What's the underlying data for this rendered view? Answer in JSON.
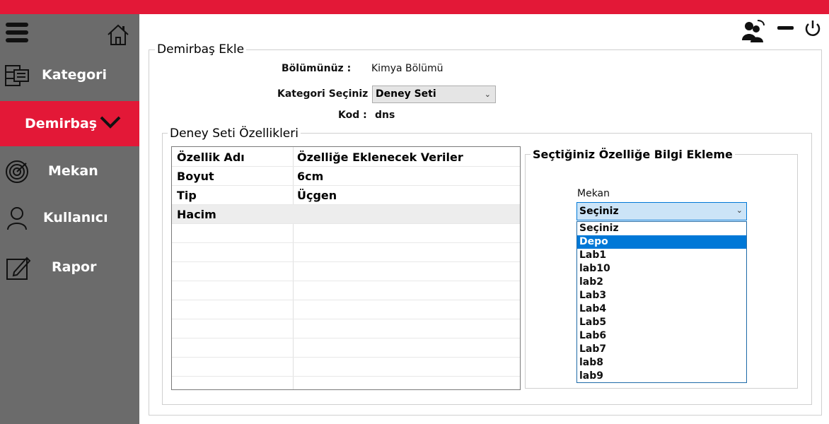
{
  "colors": {
    "accent": "#e31837",
    "sidebar": "#6b6b6b",
    "highlight": "#0078d7"
  },
  "sidebar": {
    "items": [
      {
        "label": "Kategori",
        "icon": "server-icon"
      },
      {
        "label": "Demirbaş",
        "icon": "chevron-down-icon",
        "active": true
      },
      {
        "label": "Mekan",
        "icon": "radar-icon"
      },
      {
        "label": "Kullanıcı",
        "icon": "user-icon"
      },
      {
        "label": "Rapor",
        "icon": "edit-icon"
      }
    ]
  },
  "form": {
    "title": "Demirbaş Ekle",
    "department_label": "Bölümünüz :",
    "department_value": "Kimya Bölümü",
    "category_label": "Kategori Seçiniz :",
    "category_value": "Deney Seti",
    "code_label": "Kod :",
    "code_value": "dns"
  },
  "properties": {
    "title": "Deney Seti Özellikleri",
    "columns": [
      "Özellik Adı",
      "Özelliğe Eklenecek Veriler"
    ],
    "rows": [
      [
        "Boyut",
        "6cm"
      ],
      [
        "Tip",
        "Üçgen"
      ],
      [
        "Hacim",
        ""
      ]
    ]
  },
  "info_panel": {
    "title": "Seçtiğiniz Özelliğe Bilgi Ekleme",
    "location_label": "Mekan",
    "location_value": "Seçiniz",
    "options": [
      "Seçiniz",
      "Depo",
      "Lab1",
      "lab10",
      "lab2",
      "Lab3",
      "Lab4",
      "Lab5",
      "Lab6",
      "Lab7",
      "lab8",
      "lab9"
    ],
    "highlighted": "Depo"
  }
}
